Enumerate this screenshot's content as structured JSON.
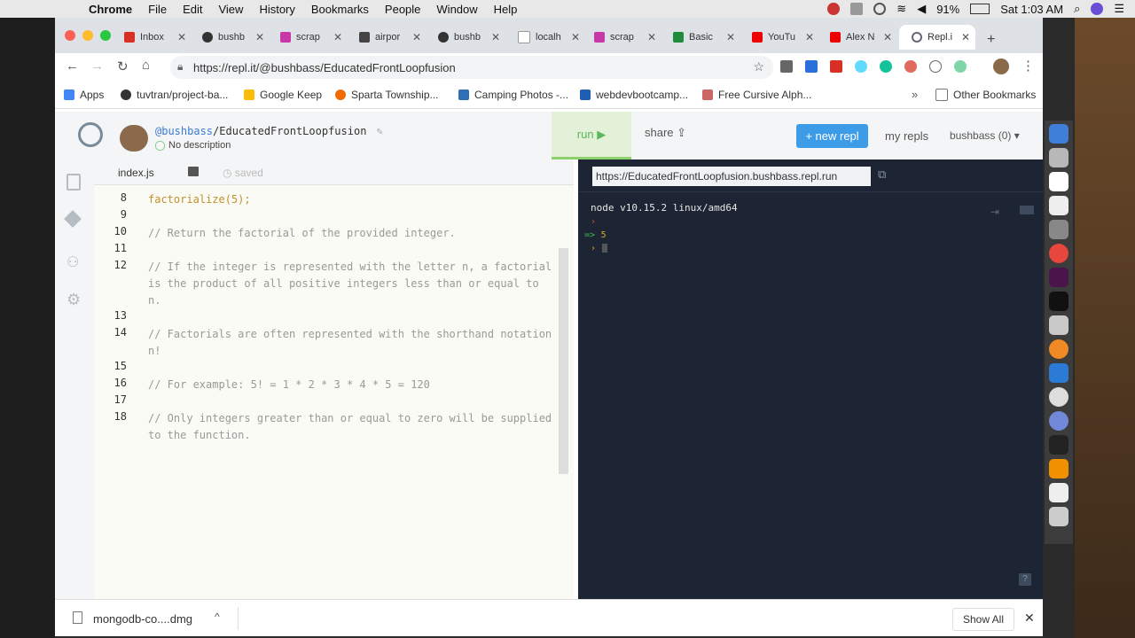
{
  "menubar": {
    "app_name": "Chrome",
    "items": [
      "File",
      "Edit",
      "View",
      "History",
      "Bookmarks",
      "People",
      "Window",
      "Help"
    ],
    "battery": "91%",
    "clock": "Sat 1:03 AM"
  },
  "tabs": [
    "Inbox",
    "bushb",
    "scrap",
    "airpor",
    "bushb",
    "localh",
    "scrap",
    "Basic",
    "YouTu",
    "Alex N",
    "Repl.i"
  ],
  "address_bar": {
    "url": "https://repl.it/@bushbass/EducatedFrontLoopfusion"
  },
  "bookmarks": [
    "Apps",
    "tuvtran/project-ba...",
    "Google Keep",
    "Sparta Township...",
    "Camping Photos -...",
    "webdevbootcamp...",
    "Free Cursive Alph...",
    "Other Bookmarks"
  ],
  "repl": {
    "user": "@bushbass",
    "project": "/EducatedFrontLoopfusion",
    "description": "No description",
    "run_label": "run ▶",
    "share_label": "share",
    "new_repl_label": "+ new repl",
    "my_repls_label": "my repls",
    "user_menu": "bushbass (0) ▾"
  },
  "editor": {
    "filename": "index.js",
    "save_status": "saved",
    "lines": [
      {
        "n": "8",
        "text": "factorialize(5);"
      },
      {
        "n": "9",
        "text": ""
      },
      {
        "n": "10",
        "text": "// Return the factorial of the provided integer."
      },
      {
        "n": "11",
        "text": ""
      },
      {
        "n": "12",
        "text": "// If the integer is represented with the letter n, a factorial is the product of all positive integers less than or equal to n."
      },
      {
        "n": "13",
        "text": ""
      },
      {
        "n": "14",
        "text": "// Factorials are often represented with the shorthand notation n!"
      },
      {
        "n": "15",
        "text": ""
      },
      {
        "n": "16",
        "text": "// For example: 5! = 1 * 2 * 3 * 4 * 5 = 120"
      },
      {
        "n": "17",
        "text": ""
      },
      {
        "n": "18",
        "text": "// Only integers greater than or equal to zero will be supplied to the function."
      }
    ]
  },
  "console": {
    "url": "https://EducatedFrontLoopfusion.bushbass.repl.run",
    "header": "node v10.15.2 linux/amd64",
    "prompt": "›",
    "result_arrow": "=>",
    "result_value": "5"
  },
  "downloads": {
    "file": "mongodb-co....dmg",
    "show_all": "Show All"
  },
  "colors": {
    "console_bg": "#1d2433",
    "run_green": "#5cb85c",
    "new_repl_blue": "#3c9ce8"
  }
}
